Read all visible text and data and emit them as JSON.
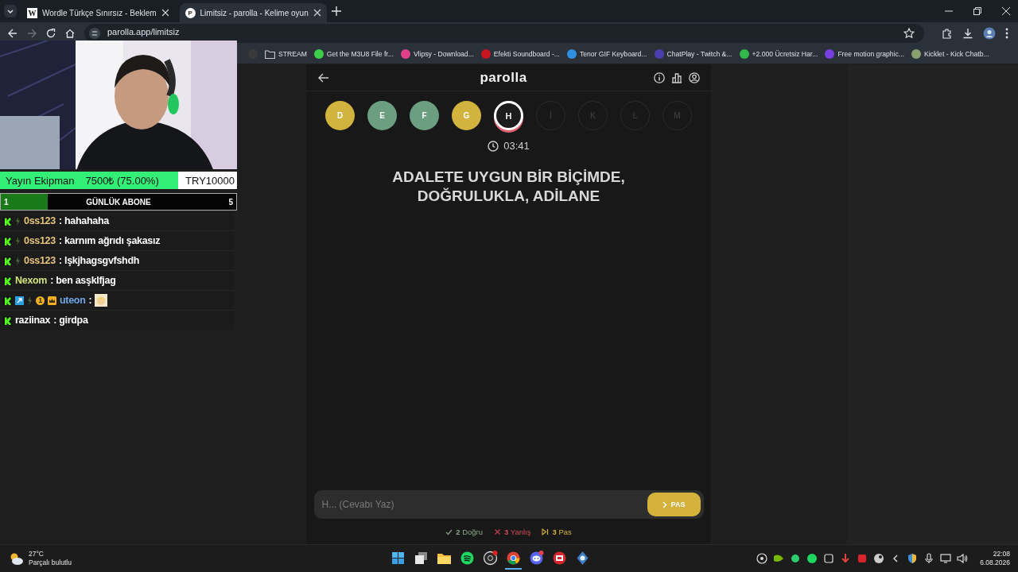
{
  "browser": {
    "tabs": [
      {
        "icon_text": "W",
        "title": "Wordle Türkçe Sınırsız - Beklem",
        "selected": false
      },
      {
        "icon_text": "P",
        "title": "Limitsiz - parolla - Kelime oyun",
        "selected": true
      }
    ],
    "address": "parolla.app/limitsiz",
    "bookmarks": [
      {
        "kind": "site",
        "color": "#3a3a3a"
      },
      {
        "kind": "folder",
        "label": "STREAM"
      },
      {
        "kind": "site",
        "color": "#3ecf4a",
        "label": "Get the M3U8 File fr..."
      },
      {
        "kind": "site",
        "color": "#e0408a",
        "label": "Vlipsy - Download..."
      },
      {
        "kind": "site",
        "color": "#c8141e",
        "label": "Efekti Soundboard -..."
      },
      {
        "kind": "site",
        "color": "#2f8fe0",
        "label": "Tenor GIF Keyboard..."
      },
      {
        "kind": "site",
        "color": "#4a3fb0",
        "label": "ChatPlay - Twitch &..."
      },
      {
        "kind": "site",
        "color": "#30b84a",
        "label": "+2.000 Ücretsiz Har..."
      },
      {
        "kind": "site",
        "color": "#7a3fe0",
        "label": "Free motion graphic..."
      },
      {
        "kind": "site",
        "color": "#8aa070",
        "label": "Kicklet - Kick Chatb..."
      }
    ]
  },
  "stream_overlay": {
    "goal": {
      "label": "Yayın Ekipman",
      "amount": "7500₺ (75.00%)",
      "target": "TRY10000",
      "level": 0.75
    },
    "sub_goal": {
      "start": "1",
      "label": "GÜNLÜK ABONE",
      "end": "5",
      "level": 0.2
    },
    "chat": [
      {
        "badges": [
          {
            "kind": "kick"
          },
          {
            "kind": "bolt"
          }
        ],
        "user": "0ss123",
        "color": "#e6c47c",
        "kind": "text",
        "text": ": hahahaha"
      },
      {
        "badges": [
          {
            "kind": "kick"
          },
          {
            "kind": "bolt"
          }
        ],
        "user": "0ss123",
        "color": "#e6c47c",
        "kind": "text",
        "text": ": karnım ağrıdı şakasız"
      },
      {
        "badges": [
          {
            "kind": "kick"
          },
          {
            "kind": "bolt"
          }
        ],
        "user": "0ss123",
        "color": "#e6c47c",
        "kind": "text",
        "text": ": lşkjhagsgvfshdh"
      },
      {
        "badges": [
          {
            "kind": "kick"
          }
        ],
        "user": "Nexom",
        "color": "#cfe27c",
        "kind": "text",
        "text": ": ben asşklfjag"
      },
      {
        "badges": [
          {
            "kind": "kick"
          },
          {
            "kind": "boost"
          },
          {
            "kind": "bolt"
          },
          {
            "kind": "count",
            "text": "1"
          },
          {
            "kind": "crown"
          }
        ],
        "user": "uteon",
        "color": "#6ea4e6",
        "kind": "emote",
        "text": ":"
      },
      {
        "badges": [
          {
            "kind": "kick"
          }
        ],
        "user": "raziinax",
        "color": "#ffffff",
        "kind": "text",
        "text": ": girdpa"
      }
    ]
  },
  "game": {
    "title": "parolla",
    "letters": [
      {
        "letter": "D",
        "kind": "passed"
      },
      {
        "letter": "E",
        "kind": "correct"
      },
      {
        "letter": "F",
        "kind": "correct"
      },
      {
        "letter": "G",
        "kind": "passed"
      },
      {
        "letter": "H",
        "kind": "current"
      },
      {
        "letter": "İ",
        "kind": "pending"
      },
      {
        "letter": "K",
        "kind": "pending"
      },
      {
        "letter": "L",
        "kind": "pending"
      },
      {
        "letter": "M",
        "kind": "pending"
      }
    ],
    "timer": "03:41",
    "question": "ADALETE UYGUN BİR BİÇİMDE, DOĞRULUKLA, ADİLANE",
    "answer": {
      "placeholder": "H... (Cevabı Yaz)"
    },
    "pass_button": "PAS",
    "stats": [
      {
        "kind": "correct",
        "count": "2",
        "label": "Doğru"
      },
      {
        "kind": "wrong",
        "count": "3",
        "label": "Yanlış"
      },
      {
        "kind": "pass",
        "count": "3",
        "label": "Pas"
      }
    ]
  },
  "taskbar": {
    "temperature": "27°C",
    "weather": "Parçalı bulutlu",
    "apps": [
      {
        "kind": "windows",
        "active": false
      },
      {
        "kind": "taskview",
        "active": false
      },
      {
        "kind": "folder",
        "active": false
      },
      {
        "kind": "spotify",
        "active": false
      },
      {
        "kind": "obs",
        "active": false
      },
      {
        "kind": "chrome",
        "active": true
      },
      {
        "kind": "discord",
        "active": false
      },
      {
        "kind": "media",
        "active": false
      },
      {
        "kind": "tool",
        "active": false
      }
    ],
    "time": "22:08",
    "date": "6.08.2026"
  }
}
